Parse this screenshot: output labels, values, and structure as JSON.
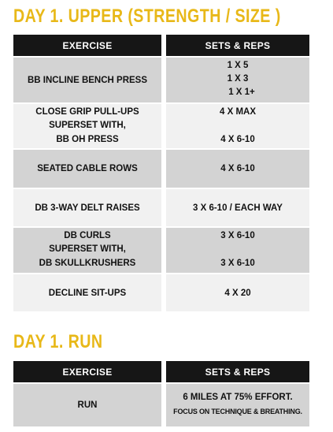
{
  "day1_upper": {
    "title": "DAY 1. UPPER (STRENGTH / SIZE )",
    "header_exercise": "EXERCISE",
    "header_sets": "SETS & REPS",
    "rows": [
      {
        "exercise": "BB INCLINE BENCH PRESS",
        "sets": [
          "1 X 5",
          "1 X 3",
          "1 X 1+"
        ]
      },
      {
        "exercise_lines": [
          "CLOSE GRIP PULL-UPS",
          "SUPERSET WITH,",
          "BB OH PRESS"
        ],
        "sets": [
          "4 X MAX",
          "4 X 6-10"
        ]
      },
      {
        "exercise": "SEATED CABLE ROWS",
        "sets": [
          "4 X 6-10"
        ]
      },
      {
        "exercise": "DB 3-WAY DELT RAISES",
        "sets": [
          "3 X 6-10 / EACH WAY"
        ]
      },
      {
        "exercise_lines": [
          "DB CURLS",
          "SUPERSET WITH,",
          "DB SKULLKRUSHERS"
        ],
        "sets": [
          "3 X 6-10",
          "3 X 6-10"
        ]
      },
      {
        "exercise": "DECLINE SIT-UPS",
        "sets": [
          "4 X 20"
        ]
      }
    ]
  },
  "day1_run": {
    "title": "DAY 1. RUN",
    "header_exercise": "EXERCISE",
    "header_sets": "SETS & REPS",
    "rows": [
      {
        "exercise": "RUN",
        "sets": [
          "6 MILES AT 75% EFFORT.",
          "FOCUS ON TECHNIQUE & BREATHING."
        ]
      }
    ]
  },
  "colors": {
    "title": "#e8b818",
    "header_bg": "#161616",
    "row_dark": "#d3d3d3",
    "row_light": "#f1f1f1"
  }
}
